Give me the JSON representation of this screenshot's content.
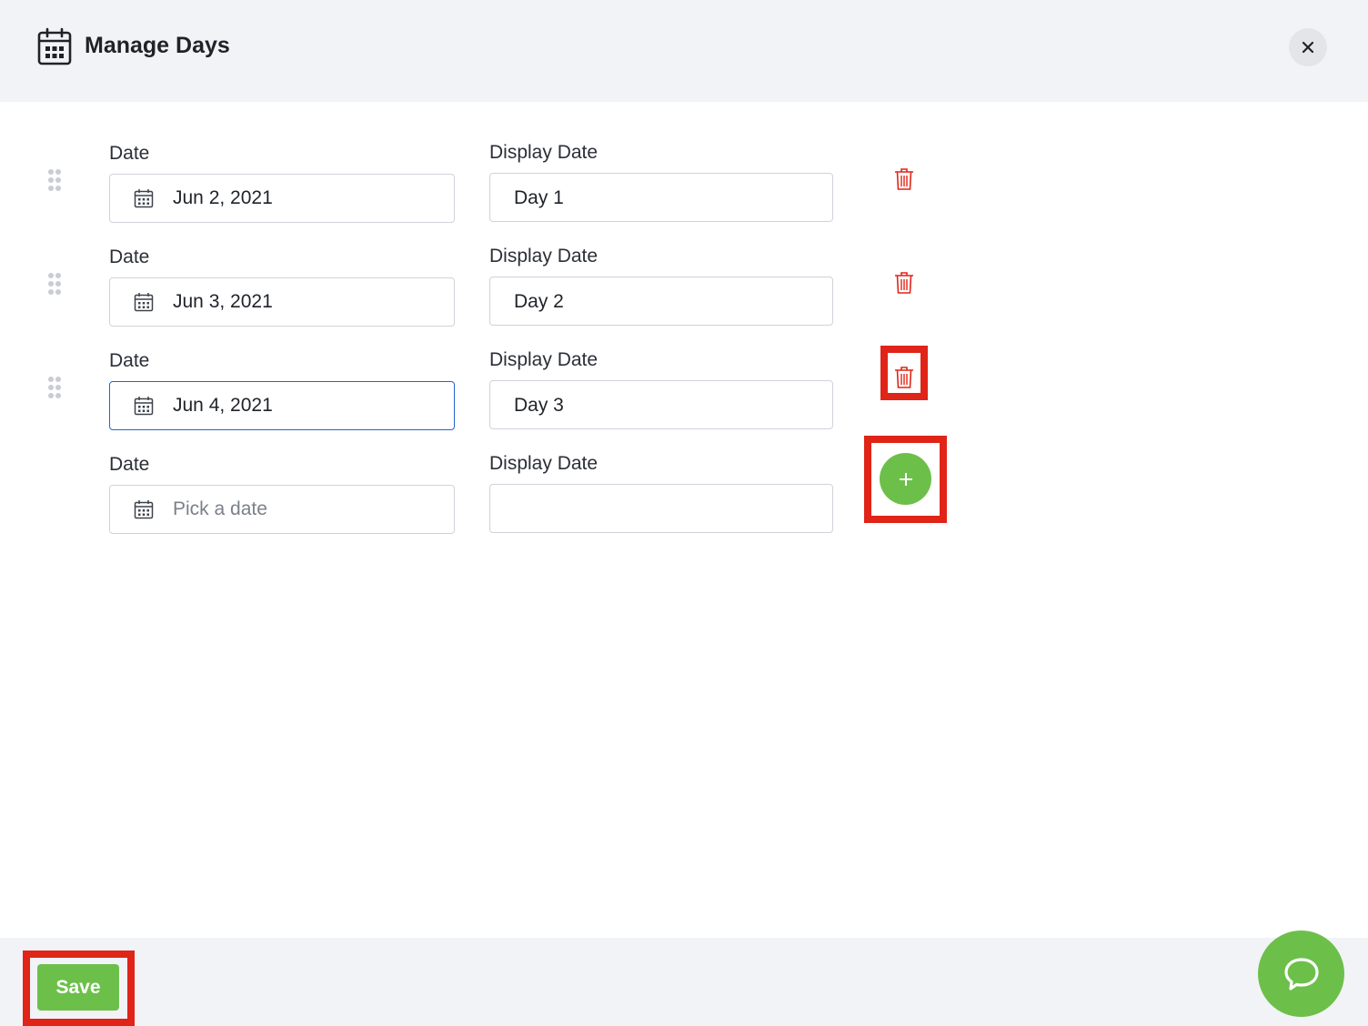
{
  "header": {
    "title": "Manage Days",
    "icon": "calendar-icon",
    "close_icon": "close-icon"
  },
  "rows": [
    {
      "date_label": "Date",
      "display_label": "Display Date",
      "date_value": "Jun 2, 2021",
      "display_value": "Day 1"
    },
    {
      "date_label": "Date",
      "display_label": "Display Date",
      "date_value": "Jun 3, 2021",
      "display_value": "Day 2"
    },
    {
      "date_label": "Date",
      "display_label": "Display Date",
      "date_value": "Jun 4, 2021",
      "display_value": "Day 3"
    }
  ],
  "new_row": {
    "date_label": "Date",
    "display_label": "Display Date",
    "date_placeholder": "Pick a date",
    "display_value": ""
  },
  "footer": {
    "save_label": "Save"
  },
  "colors": {
    "accent_green": "#6cc04a",
    "delete_red": "#e02418",
    "focus_blue": "#2264d1",
    "header_bg": "#f2f3f6"
  }
}
